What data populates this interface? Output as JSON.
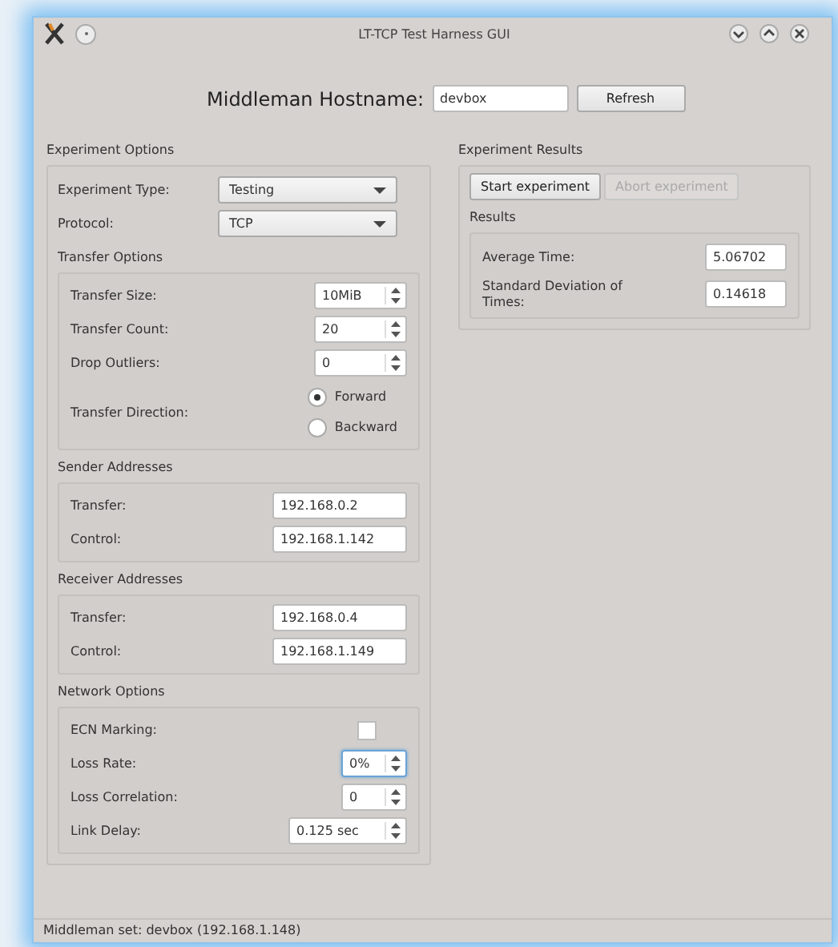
{
  "window": {
    "title": "LT-TCP Test Harness GUI"
  },
  "hostname": {
    "label": "Middleman Hostname:",
    "value": "devbox"
  },
  "refresh_button": {
    "label": "Refresh"
  },
  "experiment_options": {
    "title": "Experiment Options",
    "fields": [
      {
        "label": "Experiment Type:",
        "value": "Testing"
      },
      {
        "label": "Protocol:",
        "value": "TCP"
      }
    ],
    "groups": [
      {
        "title": "Transfer Options",
        "rows": [
          {
            "kind": "spin",
            "label": "Transfer Size:",
            "value": "10MiB",
            "focused": false
          },
          {
            "kind": "spin",
            "label": "Transfer Count:",
            "value": "20",
            "focused": false
          },
          {
            "kind": "spin",
            "label": "Drop Outliers:",
            "value": "0",
            "focused": false
          },
          {
            "kind": "radio",
            "label": "Transfer Direction:",
            "options": [
              {
                "label": "Forward",
                "selected": true
              },
              {
                "label": "Backward",
                "selected": false
              }
            ]
          }
        ]
      },
      {
        "title": "Sender Addresses",
        "rows": [
          {
            "kind": "text",
            "label": "Transfer:",
            "value": "192.168.0.2"
          },
          {
            "kind": "text",
            "label": "Control:",
            "value": "192.168.1.142"
          }
        ]
      },
      {
        "title": "Receiver Addresses",
        "rows": [
          {
            "kind": "text",
            "label": "Transfer:",
            "value": "192.168.0.4"
          },
          {
            "kind": "text",
            "label": "Control:",
            "value": "192.168.1.149"
          }
        ]
      },
      {
        "title": "Network Options",
        "rows": [
          {
            "kind": "check",
            "label": "ECN Marking:",
            "checked": false
          },
          {
            "kind": "spin",
            "label": "Loss Rate:",
            "value": "0%",
            "focused": true
          },
          {
            "kind": "spin",
            "label": "Loss Correlation:",
            "value": "0",
            "focused": false
          },
          {
            "kind": "spin",
            "label": "Link Delay:",
            "value": "0.125 sec",
            "focused": false
          }
        ]
      }
    ]
  },
  "experiment_results": {
    "title": "Experiment Results",
    "buttons": [
      {
        "label": "Start experiment",
        "disabled": false
      },
      {
        "label": "Abort experiment",
        "disabled": true
      }
    ],
    "results": {
      "title": "Results",
      "rows": [
        {
          "label": "Average Time:",
          "value": "5.06702"
        },
        {
          "label": "Standard Deviation of Times:",
          "value": "0.14618"
        }
      ]
    }
  },
  "status_bar": "Middleman set: devbox (192.168.1.148)"
}
